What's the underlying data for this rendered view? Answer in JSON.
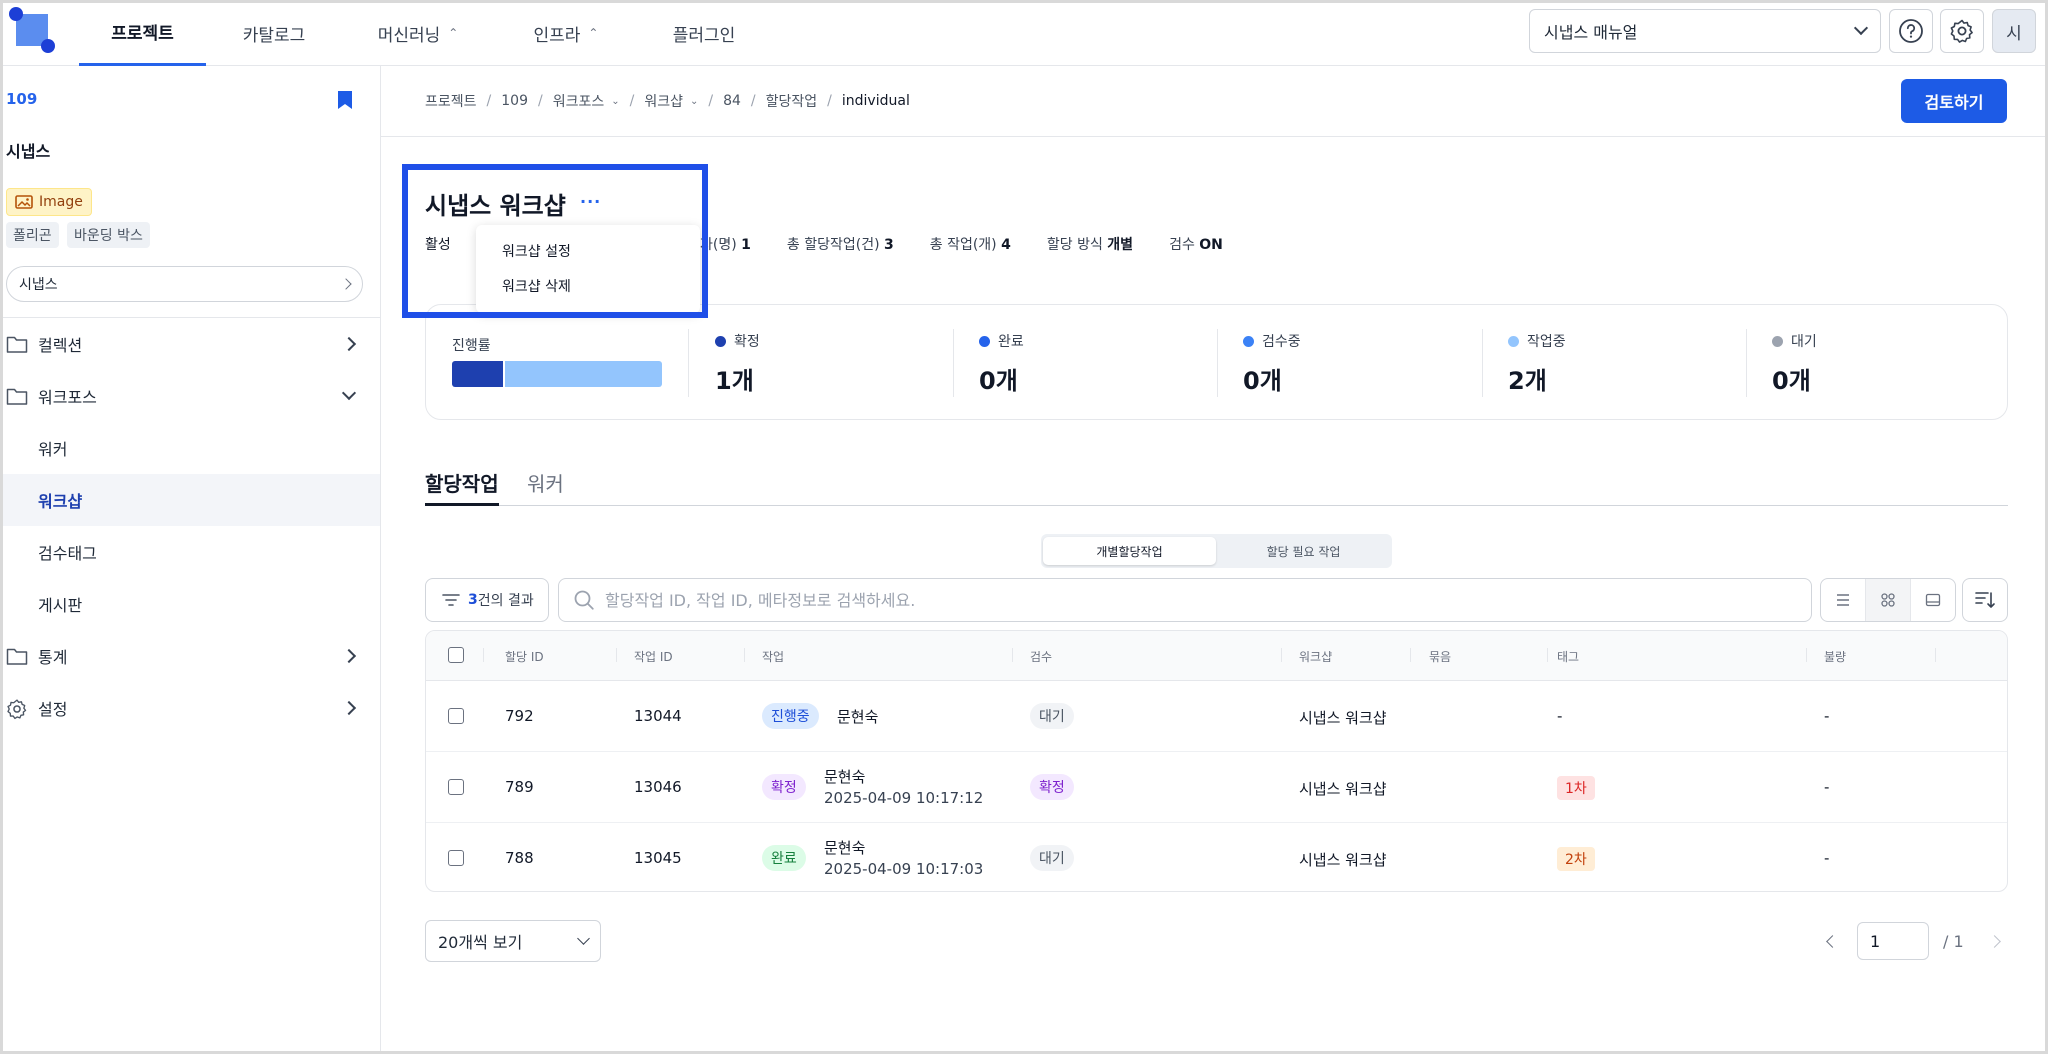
{
  "nav": {
    "tabs": [
      {
        "label": "프로젝트",
        "chevron": ""
      },
      {
        "label": "카탈로그",
        "chevron": ""
      },
      {
        "label": "머신러닝",
        "chevron": "⌃⌄"
      },
      {
        "label": "인프라",
        "chevron": "⌃⌄"
      },
      {
        "label": "플러그인",
        "chevron": ""
      }
    ],
    "manual": "시냅스 매뉴얼",
    "avatar": "시",
    "icons": [
      "help-icon",
      "gear-icon"
    ]
  },
  "sidebar": {
    "project_id": "109",
    "project_name": "시냅스",
    "data_type": "Image",
    "annotation_tags": [
      "폴리곤",
      "바운딩 박스"
    ],
    "select_value": "시냅스",
    "items": [
      {
        "label": "컬렉션",
        "icon": "folder-icon"
      },
      {
        "label": "워크포스",
        "icon": "folder-icon"
      },
      {
        "label": "통계",
        "icon": "folder-icon"
      },
      {
        "label": "설정",
        "icon": "gear-icon"
      }
    ],
    "sub_items": [
      "워커",
      "워크샵",
      "검수태그",
      "게시판"
    ]
  },
  "breadcrumb": [
    "프로젝트",
    "109",
    "워크포스",
    "워크샵",
    "84",
    "할당작업",
    "individual"
  ],
  "review_button": "검토하기",
  "workshop": {
    "title": "시냅스 워크샵",
    "more": "···",
    "status": "활성",
    "menu": [
      "워크샵 설정",
      "워크샵 삭제"
    ],
    "stats": [
      {
        "label": "자(명)",
        "value": "1"
      },
      {
        "label": "총 할당작업(건)",
        "value": "3"
      },
      {
        "label": "총 작업(개)",
        "value": "4"
      },
      {
        "label": "할당 방식",
        "value": "개별"
      },
      {
        "label": "검수",
        "value": "ON"
      }
    ]
  },
  "progress": {
    "label": "진행률",
    "fractions": [
      0.25,
      0.75
    ],
    "colors": [
      "#1e40af",
      "#93c5fd"
    ],
    "cols": [
      {
        "label": "확정",
        "value": "1개",
        "color": "#1e40af"
      },
      {
        "label": "완료",
        "value": "0개",
        "color": "#2563eb"
      },
      {
        "label": "검수중",
        "value": "0개",
        "color": "#3b82f6"
      },
      {
        "label": "작업중",
        "value": "2개",
        "color": "#93c5fd"
      },
      {
        "label": "대기",
        "value": "0개",
        "color": "#9ca3af"
      }
    ]
  },
  "tabs": [
    "할당작업",
    "워커"
  ],
  "segment": [
    "개별할당작업",
    "할당 필요 작업"
  ],
  "filter": {
    "count": "3",
    "suffix": "건의 결과"
  },
  "search_placeholder": "할당작업 ID, 작업 ID, 메타정보로 검색하세요.",
  "table": {
    "headers": [
      "할당 ID",
      "작업 ID",
      "작업",
      "검수",
      "워크샵",
      "묶음",
      "태그",
      "불량"
    ],
    "rows": [
      {
        "assign_id": "792",
        "task_id": "13044",
        "task_status": "진행중",
        "task_status_color": "blue",
        "worker": "문현숙",
        "time": "",
        "review": "대기",
        "review_color": "gray",
        "workshop": "시냅스 워크샵",
        "tag": "-",
        "tag_color": "",
        "defect": "-"
      },
      {
        "assign_id": "789",
        "task_id": "13046",
        "task_status": "확정",
        "task_status_color": "purple",
        "worker": "문현숙",
        "time": "2025-04-09 10:17:12",
        "review": "확정",
        "review_color": "purple",
        "workshop": "시냅스 워크샵",
        "tag": "1차",
        "tag_color": "red",
        "defect": "-"
      },
      {
        "assign_id": "788",
        "task_id": "13045",
        "task_status": "완료",
        "task_status_color": "green",
        "worker": "문현숙",
        "time": "2025-04-09 10:17:03",
        "review": "대기",
        "review_color": "gray",
        "workshop": "시냅스 워크샵",
        "tag": "2차",
        "tag_color": "orange",
        "defect": "-"
      }
    ]
  },
  "pagination": {
    "page_size": "20개씩 보기",
    "current_page": "1",
    "total": "/ 1"
  }
}
